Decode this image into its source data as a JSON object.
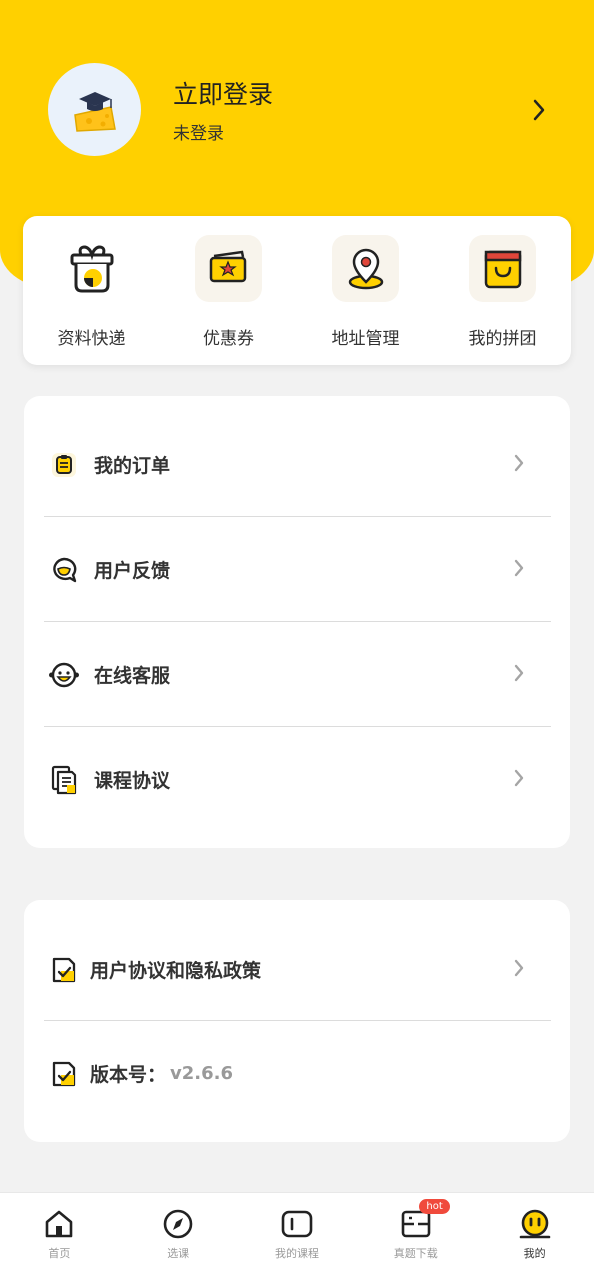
{
  "profile": {
    "title": "立即登录",
    "subtitle": "未登录"
  },
  "quick_actions": [
    {
      "label": "资料快递",
      "icon": "gift-box-icon"
    },
    {
      "label": "优惠券",
      "icon": "coupon-icon"
    },
    {
      "label": "地址管理",
      "icon": "location-pin-icon"
    },
    {
      "label": "我的拼团",
      "icon": "shopping-bag-icon"
    }
  ],
  "menu": {
    "orders": "我的订单",
    "feedback": "用户反馈",
    "service": "在线客服",
    "agreement": "课程协议"
  },
  "settings": {
    "privacy": "用户协议和隐私政策",
    "version_label": "版本号：",
    "version_value": "v2.6.6"
  },
  "tabbar": {
    "tabs": [
      {
        "label": "首页",
        "icon": "home-icon"
      },
      {
        "label": "选课",
        "icon": "compass-icon"
      },
      {
        "label": "我的课程",
        "icon": "course-icon"
      },
      {
        "label": "真题下载",
        "icon": "download-icon"
      },
      {
        "label": "我的",
        "icon": "profile-icon"
      }
    ],
    "hot_badge": "hot",
    "active": "我的"
  },
  "colors": {
    "brand_yellow": "#FFD000",
    "badge_red": "#f04a3c"
  }
}
